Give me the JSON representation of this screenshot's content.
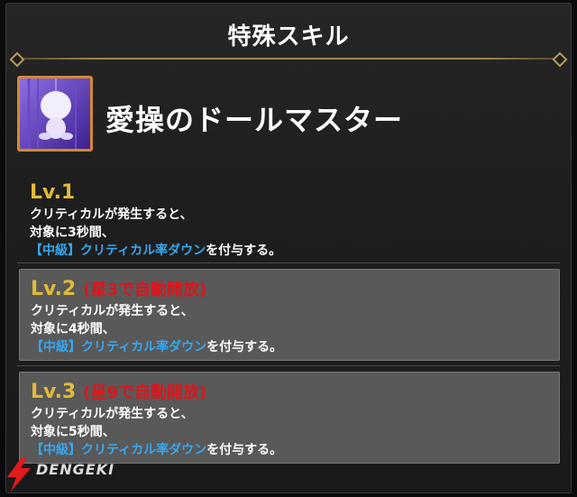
{
  "header": {
    "title": "特殊スキル"
  },
  "skill": {
    "name": "愛操のドールマスター",
    "icon": "doll-character-icon"
  },
  "levels": [
    {
      "label": "Lv.1",
      "unlock": "",
      "line1": "クリティカルが発生すると、",
      "line2": "対象に3秒間、",
      "highlight": "【中級】クリティカル率ダウン",
      "suffix": "を付与する。"
    },
    {
      "label": "Lv.2",
      "unlock": "(星3で自動開放)",
      "line1": "クリティカルが発生すると、",
      "line2": "対象に4秒間、",
      "highlight": "【中級】クリティカル率ダウン",
      "suffix": "を付与する。"
    },
    {
      "label": "Lv.3",
      "unlock": "(星9で自動開放)",
      "line1": "クリティカルが発生すると、",
      "line2": "対象に5秒間、",
      "highlight": "【中級】クリティカル率ダウン",
      "suffix": "を付与する。"
    }
  ],
  "colors": {
    "level_label": "#e2b93a",
    "unlock_text": "#e0141b",
    "highlight_text": "#36a7f0",
    "icon_frame": "#d48a2a"
  },
  "watermark": {
    "logo": "dengeki-logo-icon",
    "text": "DENGEKI"
  }
}
